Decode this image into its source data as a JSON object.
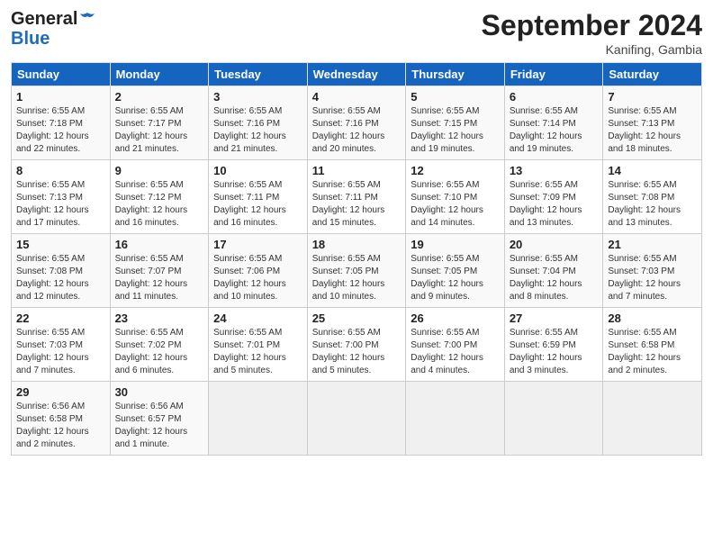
{
  "header": {
    "logo_line1": "General",
    "logo_line2": "Blue",
    "month_title": "September 2024",
    "location": "Kanifing, Gambia"
  },
  "days_of_week": [
    "Sunday",
    "Monday",
    "Tuesday",
    "Wednesday",
    "Thursday",
    "Friday",
    "Saturday"
  ],
  "weeks": [
    [
      {
        "day": "1",
        "info": "Sunrise: 6:55 AM\nSunset: 7:18 PM\nDaylight: 12 hours\nand 22 minutes."
      },
      {
        "day": "2",
        "info": "Sunrise: 6:55 AM\nSunset: 7:17 PM\nDaylight: 12 hours\nand 21 minutes."
      },
      {
        "day": "3",
        "info": "Sunrise: 6:55 AM\nSunset: 7:16 PM\nDaylight: 12 hours\nand 21 minutes."
      },
      {
        "day": "4",
        "info": "Sunrise: 6:55 AM\nSunset: 7:16 PM\nDaylight: 12 hours\nand 20 minutes."
      },
      {
        "day": "5",
        "info": "Sunrise: 6:55 AM\nSunset: 7:15 PM\nDaylight: 12 hours\nand 19 minutes."
      },
      {
        "day": "6",
        "info": "Sunrise: 6:55 AM\nSunset: 7:14 PM\nDaylight: 12 hours\nand 19 minutes."
      },
      {
        "day": "7",
        "info": "Sunrise: 6:55 AM\nSunset: 7:13 PM\nDaylight: 12 hours\nand 18 minutes."
      }
    ],
    [
      {
        "day": "8",
        "info": "Sunrise: 6:55 AM\nSunset: 7:13 PM\nDaylight: 12 hours\nand 17 minutes."
      },
      {
        "day": "9",
        "info": "Sunrise: 6:55 AM\nSunset: 7:12 PM\nDaylight: 12 hours\nand 16 minutes."
      },
      {
        "day": "10",
        "info": "Sunrise: 6:55 AM\nSunset: 7:11 PM\nDaylight: 12 hours\nand 16 minutes."
      },
      {
        "day": "11",
        "info": "Sunrise: 6:55 AM\nSunset: 7:11 PM\nDaylight: 12 hours\nand 15 minutes."
      },
      {
        "day": "12",
        "info": "Sunrise: 6:55 AM\nSunset: 7:10 PM\nDaylight: 12 hours\nand 14 minutes."
      },
      {
        "day": "13",
        "info": "Sunrise: 6:55 AM\nSunset: 7:09 PM\nDaylight: 12 hours\nand 13 minutes."
      },
      {
        "day": "14",
        "info": "Sunrise: 6:55 AM\nSunset: 7:08 PM\nDaylight: 12 hours\nand 13 minutes."
      }
    ],
    [
      {
        "day": "15",
        "info": "Sunrise: 6:55 AM\nSunset: 7:08 PM\nDaylight: 12 hours\nand 12 minutes."
      },
      {
        "day": "16",
        "info": "Sunrise: 6:55 AM\nSunset: 7:07 PM\nDaylight: 12 hours\nand 11 minutes."
      },
      {
        "day": "17",
        "info": "Sunrise: 6:55 AM\nSunset: 7:06 PM\nDaylight: 12 hours\nand 10 minutes."
      },
      {
        "day": "18",
        "info": "Sunrise: 6:55 AM\nSunset: 7:05 PM\nDaylight: 12 hours\nand 10 minutes."
      },
      {
        "day": "19",
        "info": "Sunrise: 6:55 AM\nSunset: 7:05 PM\nDaylight: 12 hours\nand 9 minutes."
      },
      {
        "day": "20",
        "info": "Sunrise: 6:55 AM\nSunset: 7:04 PM\nDaylight: 12 hours\nand 8 minutes."
      },
      {
        "day": "21",
        "info": "Sunrise: 6:55 AM\nSunset: 7:03 PM\nDaylight: 12 hours\nand 7 minutes."
      }
    ],
    [
      {
        "day": "22",
        "info": "Sunrise: 6:55 AM\nSunset: 7:03 PM\nDaylight: 12 hours\nand 7 minutes."
      },
      {
        "day": "23",
        "info": "Sunrise: 6:55 AM\nSunset: 7:02 PM\nDaylight: 12 hours\nand 6 minutes."
      },
      {
        "day": "24",
        "info": "Sunrise: 6:55 AM\nSunset: 7:01 PM\nDaylight: 12 hours\nand 5 minutes."
      },
      {
        "day": "25",
        "info": "Sunrise: 6:55 AM\nSunset: 7:00 PM\nDaylight: 12 hours\nand 5 minutes."
      },
      {
        "day": "26",
        "info": "Sunrise: 6:55 AM\nSunset: 7:00 PM\nDaylight: 12 hours\nand 4 minutes."
      },
      {
        "day": "27",
        "info": "Sunrise: 6:55 AM\nSunset: 6:59 PM\nDaylight: 12 hours\nand 3 minutes."
      },
      {
        "day": "28",
        "info": "Sunrise: 6:55 AM\nSunset: 6:58 PM\nDaylight: 12 hours\nand 2 minutes."
      }
    ],
    [
      {
        "day": "29",
        "info": "Sunrise: 6:56 AM\nSunset: 6:58 PM\nDaylight: 12 hours\nand 2 minutes."
      },
      {
        "day": "30",
        "info": "Sunrise: 6:56 AM\nSunset: 6:57 PM\nDaylight: 12 hours\nand 1 minute."
      },
      {
        "day": "",
        "info": ""
      },
      {
        "day": "",
        "info": ""
      },
      {
        "day": "",
        "info": ""
      },
      {
        "day": "",
        "info": ""
      },
      {
        "day": "",
        "info": ""
      }
    ]
  ]
}
